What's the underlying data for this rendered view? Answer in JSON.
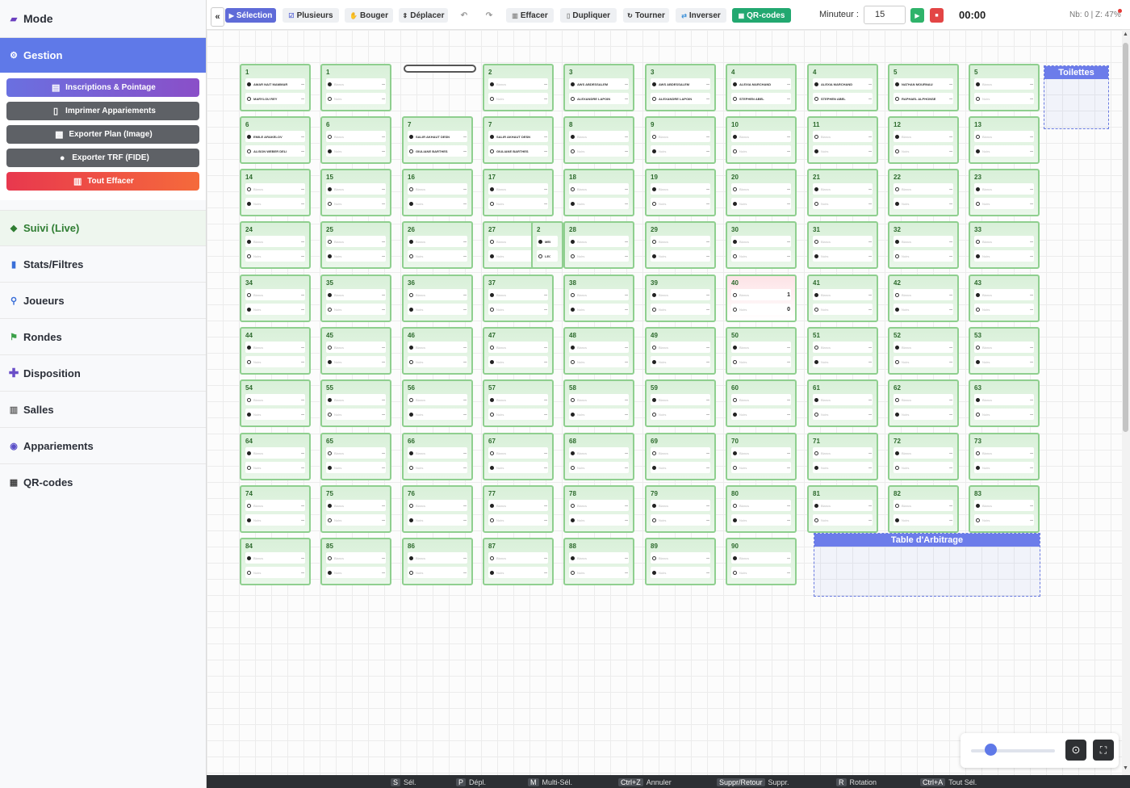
{
  "sidebar": {
    "header": "Mode",
    "gestion": "Gestion",
    "buttons": {
      "inscriptions": "Inscriptions & Pointage",
      "imprimer": "Imprimer Appariements",
      "exporter_plan": "Exporter Plan (Image)",
      "exporter_trf": "Exporter TRF (FIDE)",
      "tout_effacer": "Tout Effacer"
    },
    "items": [
      {
        "label": "Suivi (Live)",
        "icon": "spy-icon"
      },
      {
        "label": "Stats/Filtres",
        "icon": "chart-icon"
      },
      {
        "label": "Joueurs",
        "icon": "search-icon"
      },
      {
        "label": "Rondes",
        "icon": "flag-icon"
      },
      {
        "label": "Disposition",
        "icon": "plus-icon"
      },
      {
        "label": "Salles",
        "icon": "building-icon"
      },
      {
        "label": "Appariements",
        "icon": "gamepad-icon"
      },
      {
        "label": "QR-codes",
        "icon": "qr-icon"
      }
    ]
  },
  "toolbar": {
    "collapse": "«",
    "selection": "Sélection",
    "plusieurs": "Plusieurs",
    "bouger": "Bouger",
    "deplacer": "Déplacer",
    "undo": "↶",
    "redo": "↷",
    "effacer": "Effacer",
    "dupliquer": "Dupliquer",
    "tourner": "Tourner",
    "inverser": "Inverser",
    "qrcodes": "QR-codes",
    "minuteur_label": "Minuteur :",
    "minuteur_value": "15",
    "timer_display": "00:00",
    "counter": "Nb: 0 | Z: 47%"
  },
  "zones": {
    "toilettes": "Toilettes",
    "arbitrage": "Table d'Arbitrage"
  },
  "seat_placeholders": {
    "white": "Blancs",
    "black": "Noirs"
  },
  "named_tables": {
    "1a": {
      "num": "1",
      "white": "AMAR NAIT MAMMAR",
      "black": "MARYLOU REY"
    },
    "3": {
      "num": "3",
      "white": "AWS ABDESSALEM",
      "black": "ALEXANDRE LAPOIN"
    },
    "4": {
      "num": "4",
      "white": "ALEXIA MARCHAND",
      "black": "STEPHEN ABEL"
    },
    "5a": {
      "num": "5",
      "white": "NATHAN MOURNAU",
      "black": "RAPHAEL ALPHONSE"
    },
    "6a": {
      "num": "6",
      "white": "EMILE ARAKELOV",
      "black": "ALISON WEBER DELI"
    },
    "7": {
      "num": "7",
      "white": "SALIR AKHAUT DESN",
      "black": "GIULIANE BARTHES"
    },
    "2b": {
      "num": "2",
      "white": "MELINA O.",
      "black": "LEON ABA."
    }
  },
  "table40": {
    "score_white": "1",
    "score_black": "0"
  },
  "seat_score_blank": "–",
  "shortcuts": [
    {
      "key": "S",
      "label": "Sél."
    },
    {
      "key": "P",
      "label": "Dépl."
    },
    {
      "key": "M",
      "label": "Multi-Sél."
    },
    {
      "key": "Ctrl+Z",
      "label": "Annuler"
    },
    {
      "key": "Suppr/Retour",
      "label": "Suppr."
    },
    {
      "key": "R",
      "label": "Rotation"
    },
    {
      "key": "Ctrl+A",
      "label": "Tout Sél."
    }
  ],
  "colors": {
    "accent": "#5f79e8",
    "table_border": "#8fcf8f",
    "qr": "#22a870",
    "danger": "#e8384e"
  }
}
